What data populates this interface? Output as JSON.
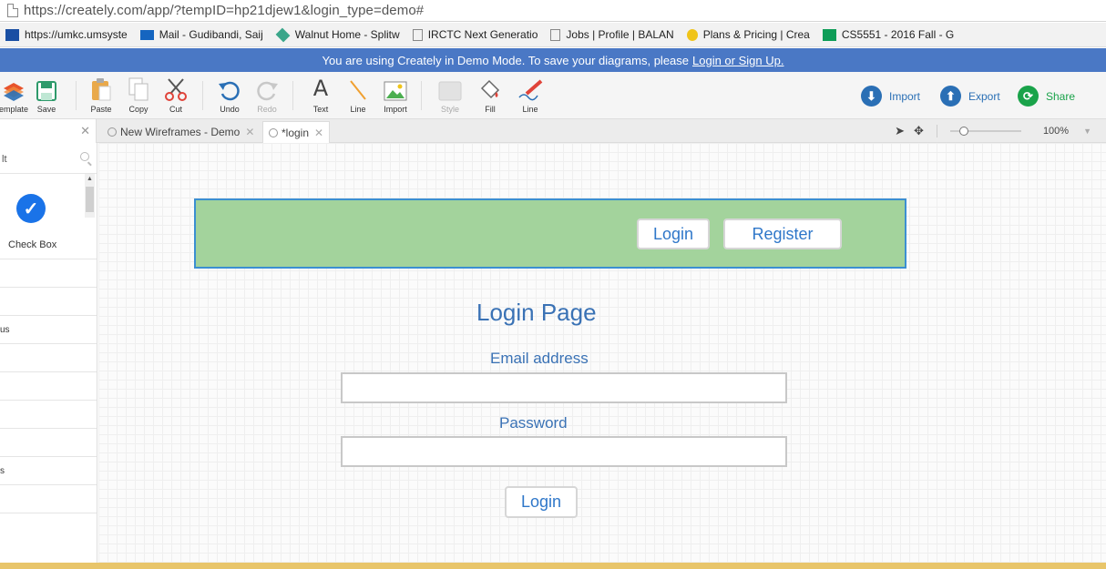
{
  "browser": {
    "url": "https://creately.com/app/?tempID=hp21djew1&login_type=demo#",
    "bookmarks": [
      {
        "label": "https://umkc.umsyste",
        "fade": "",
        "icon": "umkc",
        "color": "#1a4fa3"
      },
      {
        "label": "Mail - Gudibandi, Saij",
        "fade": "",
        "icon": "mail",
        "color": "#1565c0"
      },
      {
        "label": "Walnut Home - Splitw",
        "fade": "",
        "icon": "walnut",
        "color": "#3aa68a"
      },
      {
        "label": "IRCTC Next Generatio",
        "fade": "",
        "icon": "page",
        "color": "#888888"
      },
      {
        "label": "Jobs | Profile | BALAN",
        "fade": "",
        "icon": "page",
        "color": "#888888"
      },
      {
        "label": "Plans & Pricing | Crea",
        "fade": "",
        "icon": "bulb",
        "color": "#f0c419"
      },
      {
        "label": "CS5551 - 2016 Fall - G",
        "fade": "",
        "icon": "sheet",
        "color": "#0f9d58"
      }
    ]
  },
  "banner": {
    "text": "You are using Creately in Demo Mode. To save your diagrams, please",
    "link": "Login or Sign Up."
  },
  "toolbar": {
    "template": "emplate",
    "save": "Save",
    "paste": "Paste",
    "copy": "Copy",
    "cut": "Cut",
    "undo": "Undo",
    "redo": "Redo",
    "text": "Text",
    "line": "Line",
    "import": "Import",
    "style": "Style",
    "fill": "Fill",
    "line2": "Line",
    "import_btn": "Import",
    "export_btn": "Export",
    "share_btn": "Share",
    "colors": {
      "import": "#2a6fb5",
      "export": "#2a6fb5",
      "share": "#1aa34a"
    }
  },
  "tabs": [
    {
      "label": "New Wireframes - Demo"
    },
    {
      "label": "*login"
    }
  ],
  "zoom": "100%",
  "left_panel": {
    "search_text": "lt",
    "shape_label": "Check Box",
    "rows": [
      "",
      "",
      "us",
      "",
      "",
      "",
      "",
      "s",
      ""
    ]
  },
  "canvas": {
    "header_login": "Login",
    "header_register": "Register",
    "title": "Login Page",
    "email_label": "Email address",
    "password_label": "Password",
    "submit": "Login",
    "colors": {
      "header_fill": "#a3d39c",
      "header_border": "#3b8fd1",
      "text": "#3a72b5"
    }
  }
}
